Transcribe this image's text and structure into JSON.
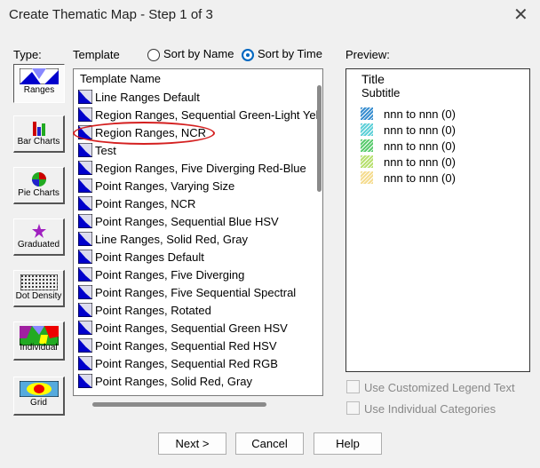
{
  "window": {
    "title": "Create Thematic Map - Step 1 of 3"
  },
  "type_label": "Type:",
  "types": [
    {
      "label": "Ranges",
      "selected": true
    },
    {
      "label": "Bar Charts"
    },
    {
      "label": "Pie Charts"
    },
    {
      "label": "Graduated"
    },
    {
      "label": "Dot Density"
    },
    {
      "label": "Individual"
    },
    {
      "label": "Grid"
    }
  ],
  "template_label": "Template",
  "sort": {
    "by_name": "Sort by Name",
    "by_time": "Sort by Time",
    "selected": "Sort by Time"
  },
  "list": {
    "header": "Template Name",
    "items": [
      "Line Ranges Default",
      "Region Ranges, Sequential Green-Light Yel",
      "Region Ranges, NCR",
      "Test",
      "Region Ranges, Five Diverging Red-Blue",
      "Point Ranges, Varying Size",
      "Point Ranges, NCR",
      "Point Ranges, Sequential Blue HSV",
      "Line Ranges, Solid Red, Gray",
      "Point Ranges Default",
      "Point Ranges, Five Diverging",
      "Point Ranges, Five Sequential Spectral",
      "Point Ranges, Rotated",
      "Point Ranges, Sequential Green HSV",
      "Point Ranges, Sequential Red HSV",
      "Point Ranges, Sequential Red RGB",
      "Point Ranges, Solid Red, Gray"
    ],
    "highlighted": "Region Ranges, NCR"
  },
  "preview": {
    "label": "Preview:",
    "title": "Title",
    "subtitle": "Subtitle",
    "legend": [
      {
        "text": "nnn to nnn  (0)",
        "color": "#3a8fd0"
      },
      {
        "text": "nnn to nnn  (0)",
        "color": "#5fd0d8"
      },
      {
        "text": "nnn to nnn  (0)",
        "color": "#5ccc70"
      },
      {
        "text": "nnn to nnn  (0)",
        "color": "#b8e070"
      },
      {
        "text": "nnn to nnn  (0)",
        "color": "#f5dc90"
      }
    ]
  },
  "options": {
    "custom_legend": "Use Customized Legend Text",
    "individual_categories": "Use Individual Categories"
  },
  "buttons": {
    "next": "Next >",
    "cancel": "Cancel",
    "help": "Help"
  }
}
